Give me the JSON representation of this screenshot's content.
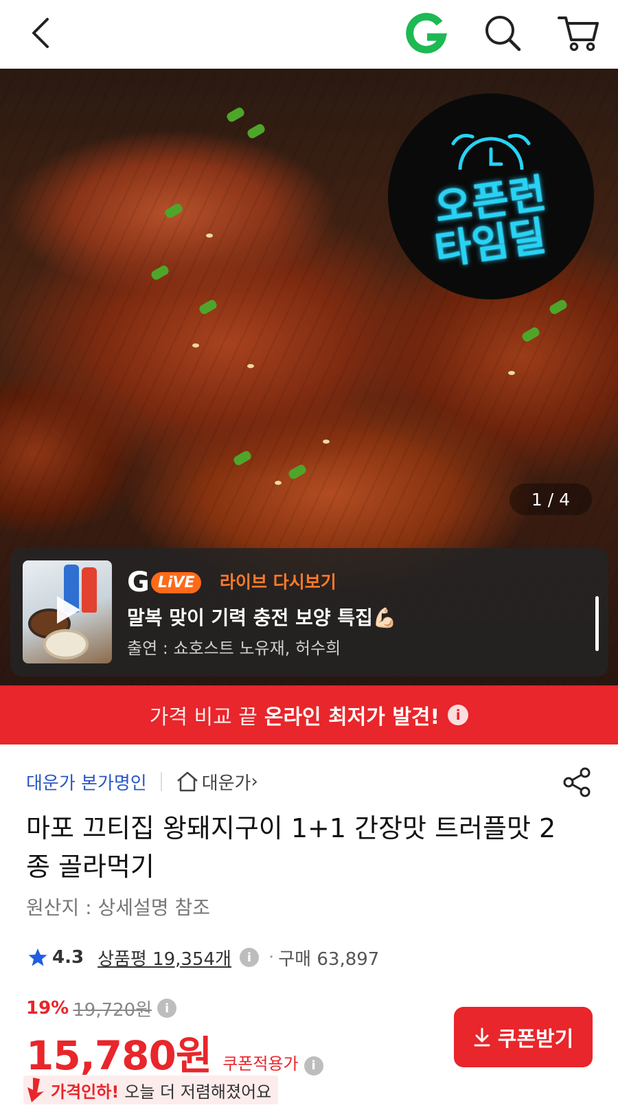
{
  "header": {
    "back_icon": "chevron-left-icon",
    "brand_logo": "G",
    "brand_color": "#1db954",
    "search_icon": "search-icon",
    "cart_icon": "cart-icon"
  },
  "hero": {
    "badge_line1": "오픈런",
    "badge_line2": "타임딜",
    "badge_color": "#27d3f5",
    "page_indicator": "1 / 4",
    "live": {
      "logo_g": "G",
      "logo_pill": "LiVE",
      "rewatch_label": "라이브 다시보기",
      "title": "말복 맞이 기력 충전 보양 특집💪🏻",
      "cast": "출연 : 쇼호스트 노유재, 허수희"
    }
  },
  "banner": {
    "plain_text": "가격 비교 끝",
    "strong_text": "온라인 최저가 발견!",
    "info_icon": "i",
    "color": "#e8262b"
  },
  "product": {
    "store_name": "대운가 본가명인",
    "brand_link": "대운가",
    "brand_chevron": "›",
    "title": "마포 끄티집 왕돼지구이 1+1 간장맛 트러플맛 2종 골라먹기",
    "origin": "원산지 : 상세설명 참조",
    "rating": "4.3",
    "review_label": "상품평 19,354개",
    "info_icon": "i",
    "dot": "·",
    "purchase_label": "구매 63,897",
    "discount_rate": "19%",
    "original_price": "19,720원",
    "price": "15,780원",
    "coupon_price_label": "쿠폰적용가",
    "coupon_button": "쿠폰받기",
    "price_drop_bold": "가격인하!",
    "price_drop_text": "오늘 더 저렴해졌어요",
    "accent_color": "#e8262b",
    "link_color": "#2a56c6"
  }
}
